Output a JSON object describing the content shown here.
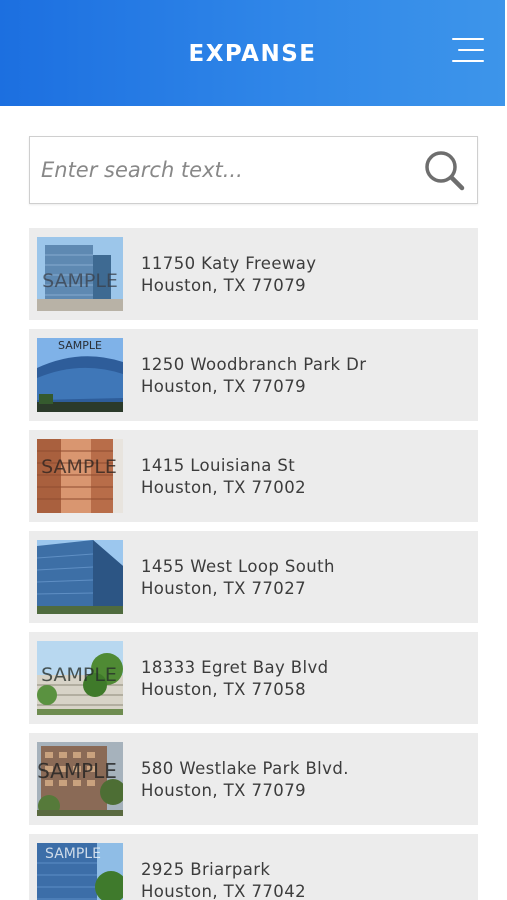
{
  "header": {
    "logo_text": "EXPANSE",
    "menu_icon": "hamburger-menu-icon",
    "colors": {
      "gradient_start": "#1c6fe0",
      "gradient_end": "#3d95ea"
    }
  },
  "search": {
    "placeholder": "Enter search text...",
    "value": "",
    "icon": "search-icon"
  },
  "properties": [
    {
      "line1": "11750 Katy Freeway",
      "line2": "Houston, TX 77079",
      "watermark": "SAMPLE"
    },
    {
      "line1": "1250 Woodbranch Park Dr",
      "line2": "Houston, TX 77079",
      "watermark": "SAMPLE"
    },
    {
      "line1": "1415 Louisiana St",
      "line2": "Houston, TX 77002",
      "watermark": "SAMPLE"
    },
    {
      "line1": "1455 West Loop South",
      "line2": "Houston, TX 77027",
      "watermark": ""
    },
    {
      "line1": "18333 Egret Bay Blvd",
      "line2": "Houston, TX 77058",
      "watermark": "SAMPLE"
    },
    {
      "line1": "580 Westlake Park Blvd.",
      "line2": "Houston, TX 77079",
      "watermark": "SAMPLE"
    },
    {
      "line1": "2925 Briarpark",
      "line2": "Houston, TX 77042",
      "watermark": "SAMPLE"
    }
  ]
}
